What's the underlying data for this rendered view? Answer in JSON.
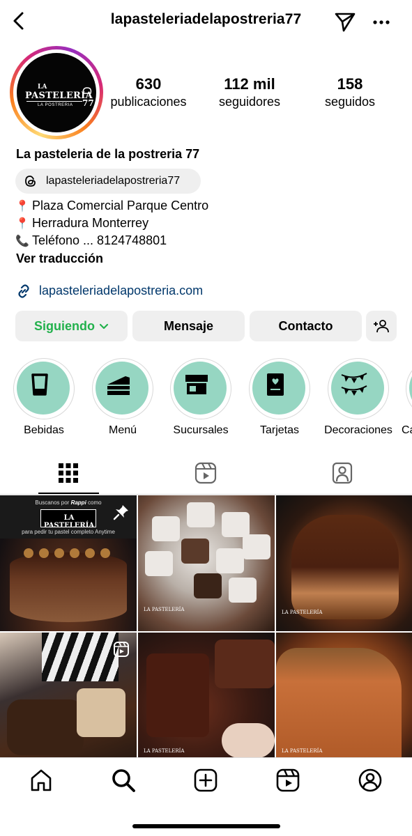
{
  "header": {
    "username": "lapasteleriadelapostreria77",
    "back_icon": "chevron-left-icon",
    "send_icon": "paper-plane-icon",
    "more_icon": "more-horizontal-icon"
  },
  "profile": {
    "avatar_logo_text": "LA PASTELERÍA 77 LA POSTRERIA",
    "stats": [
      {
        "value": "630",
        "label": "publicaciones"
      },
      {
        "value": "112 mil",
        "label": "seguidores"
      },
      {
        "value": "158",
        "label": "seguidos"
      }
    ],
    "display_name": "La pasteleria de la postreria 77",
    "threads_handle": "lapasteleriadelapostreria77",
    "bio": [
      {
        "emoji": "📍",
        "text": "Plaza Comercial Parque Centro"
      },
      {
        "emoji": "📍",
        "text": "Herradura Monterrey"
      },
      {
        "emoji": "📞",
        "text": "Teléfono ... 8124748801"
      }
    ],
    "translate_label": "Ver traducción",
    "website": "lapasteleriadelapostreria.com"
  },
  "actions": {
    "following_label": "Siguiendo",
    "message_label": "Mensaje",
    "contact_label": "Contacto",
    "add_user_icon": "add-person-icon"
  },
  "highlights": [
    {
      "label": "Bebidas",
      "icon": "glass-icon"
    },
    {
      "label": "Menú",
      "icon": "cake-slice-icon"
    },
    {
      "label": "Sucursales",
      "icon": "store-icon"
    },
    {
      "label": "Tarjetas",
      "icon": "card-heart-icon"
    },
    {
      "label": "Decoraciones",
      "icon": "bunting-icon"
    },
    {
      "label": "Ca",
      "icon": "partial-icon"
    }
  ],
  "tabs": [
    {
      "icon": "grid-icon",
      "active": true
    },
    {
      "icon": "reels-icon",
      "active": false
    },
    {
      "icon": "tagged-icon",
      "active": false
    }
  ],
  "posts": {
    "post1": {
      "caption_top_a": "Buscanos por",
      "caption_brand": "Rappi",
      "caption_top_b": "como",
      "logo_text": "LA PASTELERÍA",
      "caption_bottom": "para pedir tu pastel completo Anytime",
      "pinned": true
    },
    "watermark": "LA PASTELERÍA"
  },
  "bottom_nav": [
    {
      "icon": "home-icon"
    },
    {
      "icon": "search-icon",
      "active": true
    },
    {
      "icon": "plus-square-icon"
    },
    {
      "icon": "reels-icon"
    },
    {
      "icon": "profile-icon"
    }
  ],
  "colors": {
    "following_green": "#22b14c",
    "highlight_mint": "#96d6c2",
    "link_blue": "#00376b"
  }
}
